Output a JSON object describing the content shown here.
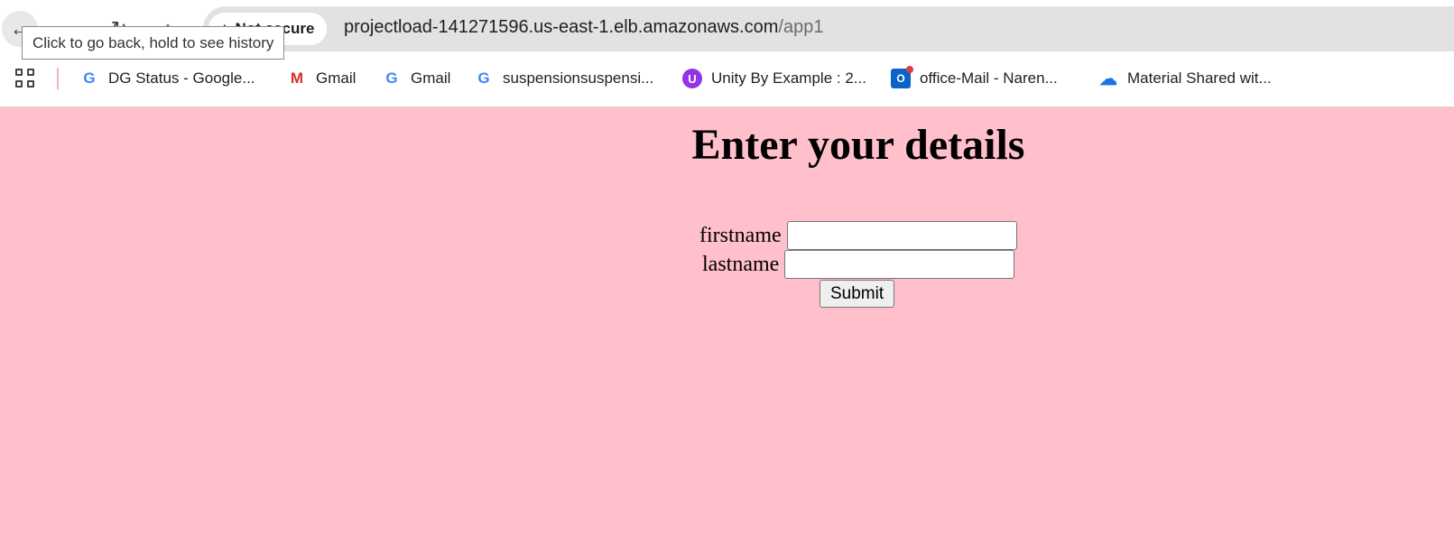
{
  "browser": {
    "tooltip": "Click to go back, hold to see history",
    "site_chip_label": "Not secure",
    "url_host": "projectload-141271596.us-east-1.elb.amazonaws.com",
    "url_path": "/app1"
  },
  "bookmarks": [
    {
      "label": "DG Status - Google...",
      "icon": "google-icon"
    },
    {
      "label": "Gmail",
      "icon": "gmail-icon"
    },
    {
      "label": "Gmail",
      "icon": "google-icon"
    },
    {
      "label": "suspensionsuspensi...",
      "icon": "google-icon"
    },
    {
      "label": "Unity By Example : 2...",
      "icon": "udemy-icon"
    },
    {
      "label": "office-Mail - Naren...",
      "icon": "outlook-icon"
    },
    {
      "label": "Material Shared wit...",
      "icon": "onedrive-icon"
    }
  ],
  "page": {
    "heading": "Enter your details",
    "firstname_label": "firstname",
    "lastname_label": "lastname",
    "firstname_value": "",
    "lastname_value": "",
    "submit_label": "Submit",
    "background_color": "#ffc0cb"
  }
}
